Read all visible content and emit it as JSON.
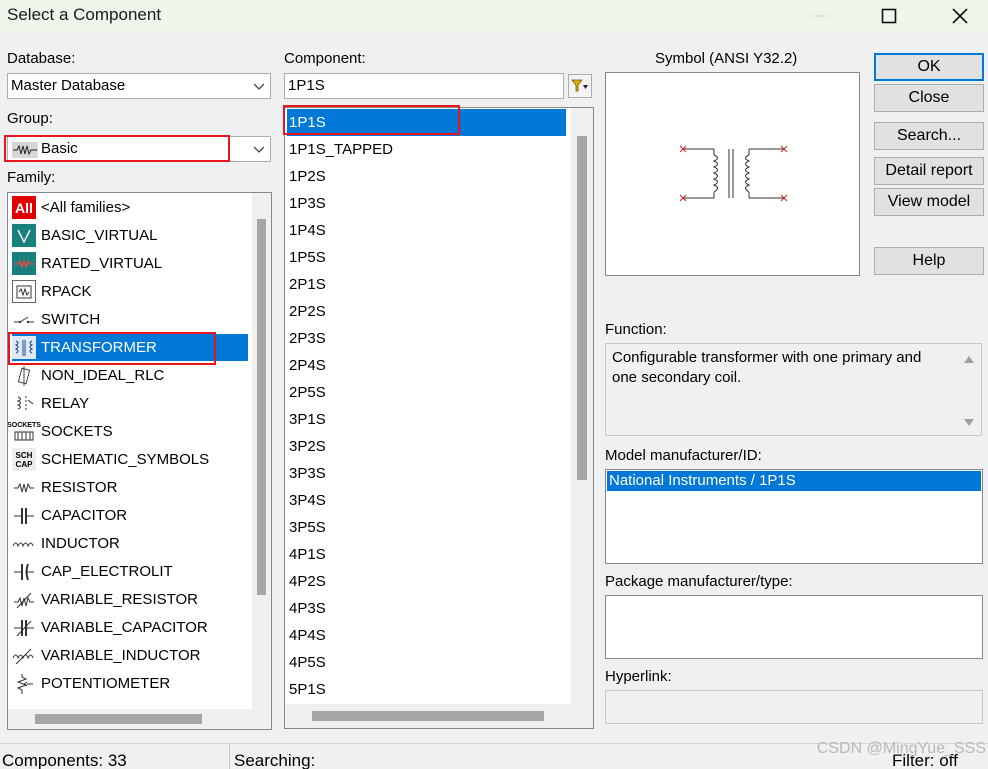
{
  "window": {
    "title": "Select a Component"
  },
  "database": {
    "label": "Database:",
    "value": "Master Database"
  },
  "group": {
    "label": "Group:",
    "value": "Basic",
    "icon": "resistor-group-icon"
  },
  "family": {
    "label": "Family:",
    "items": [
      {
        "label": "<All families>",
        "icon": "all-families-icon"
      },
      {
        "label": "BASIC_VIRTUAL",
        "icon": "basic-virtual-icon"
      },
      {
        "label": "RATED_VIRTUAL",
        "icon": "rated-virtual-icon"
      },
      {
        "label": "RPACK",
        "icon": "rpack-icon"
      },
      {
        "label": "SWITCH",
        "icon": "switch-icon"
      },
      {
        "label": "TRANSFORMER",
        "icon": "transformer-icon",
        "selected": true
      },
      {
        "label": "NON_IDEAL_RLC",
        "icon": "non-ideal-rlc-icon"
      },
      {
        "label": "RELAY",
        "icon": "relay-icon"
      },
      {
        "label": "SOCKETS",
        "icon": "sockets-icon"
      },
      {
        "label": "SCHEMATIC_SYMBOLS",
        "icon": "schematic-symbols-icon"
      },
      {
        "label": "RESISTOR",
        "icon": "resistor-icon"
      },
      {
        "label": "CAPACITOR",
        "icon": "capacitor-icon"
      },
      {
        "label": "INDUCTOR",
        "icon": "inductor-icon"
      },
      {
        "label": "CAP_ELECTROLIT",
        "icon": "cap-electrolit-icon"
      },
      {
        "label": "VARIABLE_RESISTOR",
        "icon": "variable-resistor-icon"
      },
      {
        "label": "VARIABLE_CAPACITOR",
        "icon": "variable-capacitor-icon"
      },
      {
        "label": "VARIABLE_INDUCTOR",
        "icon": "variable-inductor-icon"
      },
      {
        "label": "POTENTIOMETER",
        "icon": "potentiometer-icon"
      }
    ],
    "all_icon_text": "All",
    "sockets_icon_text": "SOCKETS",
    "sch_icon_text_1": "SCH",
    "sch_icon_text_2": "CAP"
  },
  "component": {
    "label": "Component:",
    "search_value": "1P1S",
    "filter_icon": "filter-icon",
    "items": [
      "1P1S",
      "1P1S_TAPPED",
      "1P2S",
      "1P3S",
      "1P4S",
      "1P5S",
      "2P1S",
      "2P2S",
      "2P3S",
      "2P4S",
      "2P5S",
      "3P1S",
      "3P2S",
      "3P3S",
      "3P4S",
      "3P5S",
      "4P1S",
      "4P2S",
      "4P3S",
      "4P4S",
      "4P5S",
      "5P1S"
    ],
    "selected": "1P1S"
  },
  "symbol": {
    "label": "Symbol (ANSI Y32.2)"
  },
  "buttons": {
    "ok": "OK",
    "close": "Close",
    "search": "Search...",
    "detail_report": "Detail report",
    "view_model": "View model",
    "help": "Help"
  },
  "function": {
    "label": "Function:",
    "text_line1": "Configurable transformer with one primary and",
    "text_line2": "one secondary coil."
  },
  "model": {
    "label": "Model manufacturer/ID:",
    "items": [
      "National Instruments / 1P1S"
    ]
  },
  "package": {
    "label": "Package manufacturer/type:"
  },
  "hyperlink": {
    "label": "Hyperlink:"
  },
  "status": {
    "components": "Components: 33",
    "searching": "Searching:",
    "filter": "Filter: off",
    "watermark": "CSDN @MingYue_SSS"
  },
  "colors": {
    "selection": "#0078d7",
    "highlight_box": "#e8141f",
    "titlebar": "#eef5ea"
  }
}
